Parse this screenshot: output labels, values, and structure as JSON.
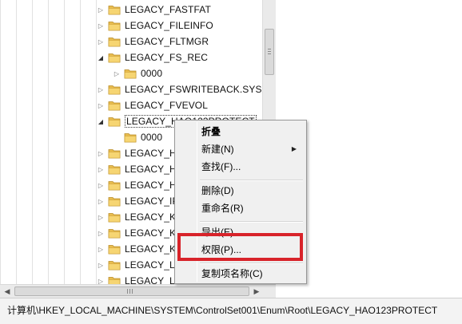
{
  "tree": {
    "rows": [
      {
        "label": "LEGACY_FASTFAT",
        "toggle": "collapsed",
        "indent": 0
      },
      {
        "label": "LEGACY_FILEINFO",
        "toggle": "collapsed",
        "indent": 0
      },
      {
        "label": "LEGACY_FLTMGR",
        "toggle": "collapsed",
        "indent": 0
      },
      {
        "label": "LEGACY_FS_REC",
        "toggle": "expanded",
        "indent": 0
      },
      {
        "label": "0000",
        "toggle": "collapsed",
        "indent": 1
      },
      {
        "label": "LEGACY_FSWRITEBACK.SYS",
        "toggle": "collapsed",
        "indent": 0
      },
      {
        "label": "LEGACY_FVEVOL",
        "toggle": "collapsed",
        "indent": 0
      },
      {
        "label": "LEGACY_HAO123PROTECT",
        "toggle": "expanded",
        "indent": 0,
        "selected": true
      },
      {
        "label": "0000",
        "toggle": "none",
        "indent": 1
      },
      {
        "label": "LEGACY_HC",
        "toggle": "collapsed",
        "indent": 0
      },
      {
        "label": "LEGACY_HT",
        "toggle": "collapsed",
        "indent": 0
      },
      {
        "label": "LEGACY_HV",
        "toggle": "collapsed",
        "indent": 0
      },
      {
        "label": "LEGACY_IP",
        "toggle": "collapsed",
        "indent": 0
      },
      {
        "label": "LEGACY_KE",
        "toggle": "collapsed",
        "indent": 0
      },
      {
        "label": "LEGACY_KS",
        "toggle": "collapsed",
        "indent": 0
      },
      {
        "label": "LEGACY_KS",
        "toggle": "collapsed",
        "indent": 0
      },
      {
        "label": "LEGACY_LL",
        "toggle": "collapsed",
        "indent": 0
      },
      {
        "label": "LEGACY_LU",
        "toggle": "collapsed",
        "indent": 0
      }
    ]
  },
  "context_menu": {
    "collapse": "折叠",
    "new": "新建(N)",
    "find": "查找(F)...",
    "delete": "删除(D)",
    "rename": "重命名(R)",
    "export": "导出(E)",
    "permissions": "权限(P)...",
    "copy_key_name": "复制项名称(C)"
  },
  "status_bar": {
    "path": "计算机\\HKEY_LOCAL_MACHINE\\SYSTEM\\ControlSet001\\Enum\\Root\\LEGACY_HAO123PROTECT"
  },
  "colors": {
    "folder": "#e9bd4f",
    "highlight_box": "#d8232a"
  }
}
